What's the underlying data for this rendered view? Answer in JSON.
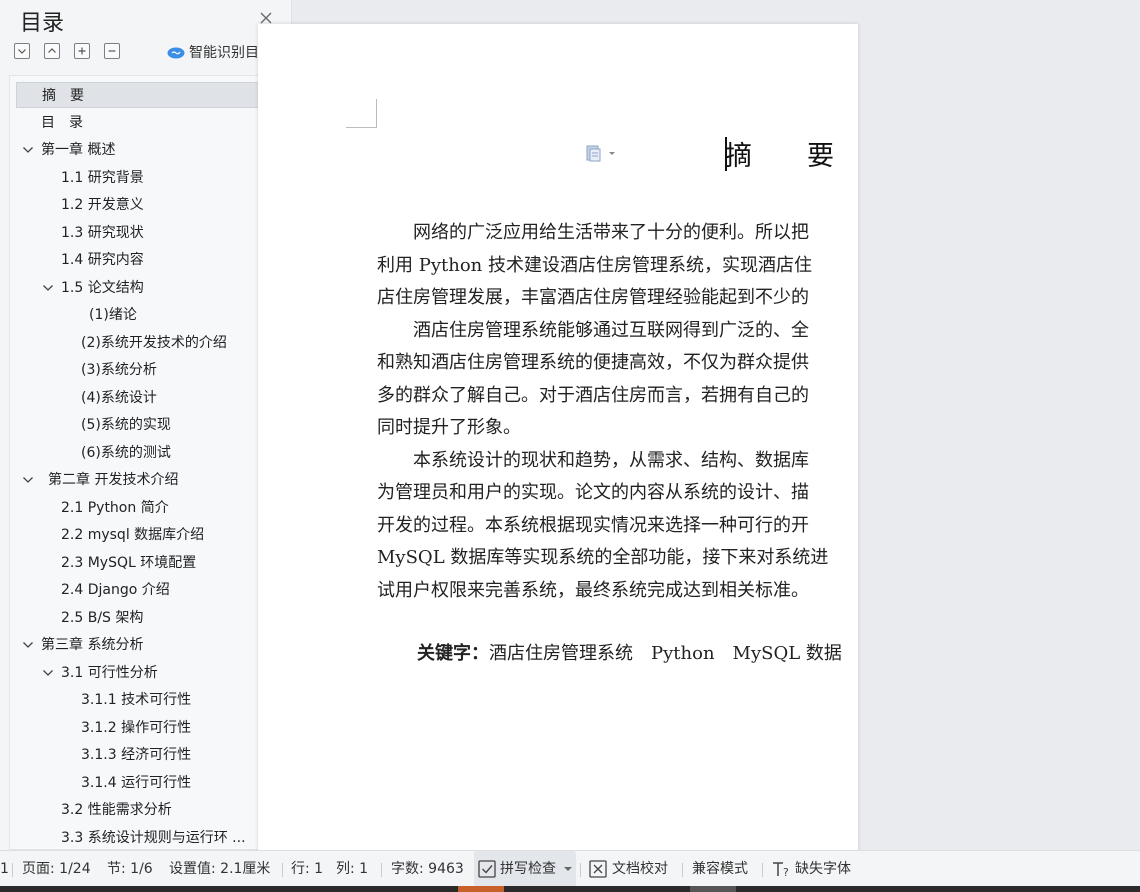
{
  "toc_panel": {
    "title": "目录",
    "smart_toc_label": "智能识别目录",
    "items": [
      {
        "label": "摘　要",
        "level": 0,
        "selected": true
      },
      {
        "label": "目　录",
        "level": 0
      },
      {
        "label": "第一章  概述",
        "level": 0,
        "expanded": true
      },
      {
        "label": "1.1  研究背景",
        "level": 1
      },
      {
        "label": "1.2  开发意义",
        "level": 1
      },
      {
        "label": "1.3  研究现状",
        "level": 1
      },
      {
        "label": "1.4  研究内容",
        "level": 1
      },
      {
        "label": "1.5  论文结构",
        "level": 1,
        "expanded": true
      },
      {
        "label": "(1)绪论",
        "level": 2
      },
      {
        "label": "(2)系统开发技术的介绍",
        "level": 2
      },
      {
        "label": "(3)系统分析",
        "level": 2
      },
      {
        "label": "(4)系统设计",
        "level": 2
      },
      {
        "label": "(5)系统的实现",
        "level": 2
      },
      {
        "label": "(6)系统的测试",
        "level": 2
      },
      {
        "label": "第二章  开发技术介绍",
        "level": 0,
        "expanded": true
      },
      {
        "label": "2.1    Python 简介",
        "level": 1
      },
      {
        "label": "2.2    mysql 数据库介绍",
        "level": 1
      },
      {
        "label": "2.3    MySQL 环境配置",
        "level": 1
      },
      {
        "label": "2.4    Django 介绍",
        "level": 1
      },
      {
        "label": "2.5    B/S 架构",
        "level": 1
      },
      {
        "label": "第三章  系统分析",
        "level": 0,
        "expanded": true
      },
      {
        "label": "3.1  可行性分析",
        "level": 1,
        "expanded": true
      },
      {
        "label": "3.1.1  技术可行性",
        "level": 2
      },
      {
        "label": "3.1.2  操作可行性",
        "level": 2
      },
      {
        "label": "3.1.3  经济可行性",
        "level": 2
      },
      {
        "label": "3.1.4  运行可行性",
        "level": 2
      },
      {
        "label": "3.2 性能需求分析",
        "level": 1
      },
      {
        "label": "3.3 系统设计规则与运行环 ...",
        "level": 1
      }
    ]
  },
  "document": {
    "title": "摘　要",
    "paragraphs": [
      "　　网络的广泛应用给生活带来了十分的便利。所以把",
      "利用 Python 技术建设酒店住房管理系统，实现酒店住",
      "店住房管理发展，丰富酒店住房管理经验能起到不少的",
      "　　酒店住房管理系统能够通过互联网得到广泛的、全",
      "和熟知酒店住房管理系统的便捷高效，不仅为群众提供",
      "多的群众了解自己。对于酒店住房而言，若拥有自己的",
      "同时提升了形象。",
      "　　本系统设计的现状和趋势，从需求、结构、数据库",
      "为管理员和用户的实现。论文的内容从系统的设计、描",
      "开发的过程。本系统根据现实情况来选择一种可行的开",
      "MySQL 数据库等实现系统的全部功能，接下来对系统进",
      "试用户权限来完善系统，最终系统完成达到相关标准。"
    ],
    "keywords_label": "关键字：",
    "keywords_text": "酒店住房管理系统　Python　MySQL 数据"
  },
  "status_bar": {
    "left_num": "1",
    "page": "页面: 1/24",
    "section": "节: 1/6",
    "setting": "设置值: 2.1厘米",
    "row": "行: 1",
    "col": "列: 1",
    "word_count": "字数: 9463",
    "spell_check": "拼写检查",
    "doc_proof": "文档校对",
    "compat_mode": "兼容模式",
    "missing_fonts": "缺失字体"
  },
  "colors": {
    "accent": "#3b8de5",
    "selected_row": "#dfe2e7"
  }
}
